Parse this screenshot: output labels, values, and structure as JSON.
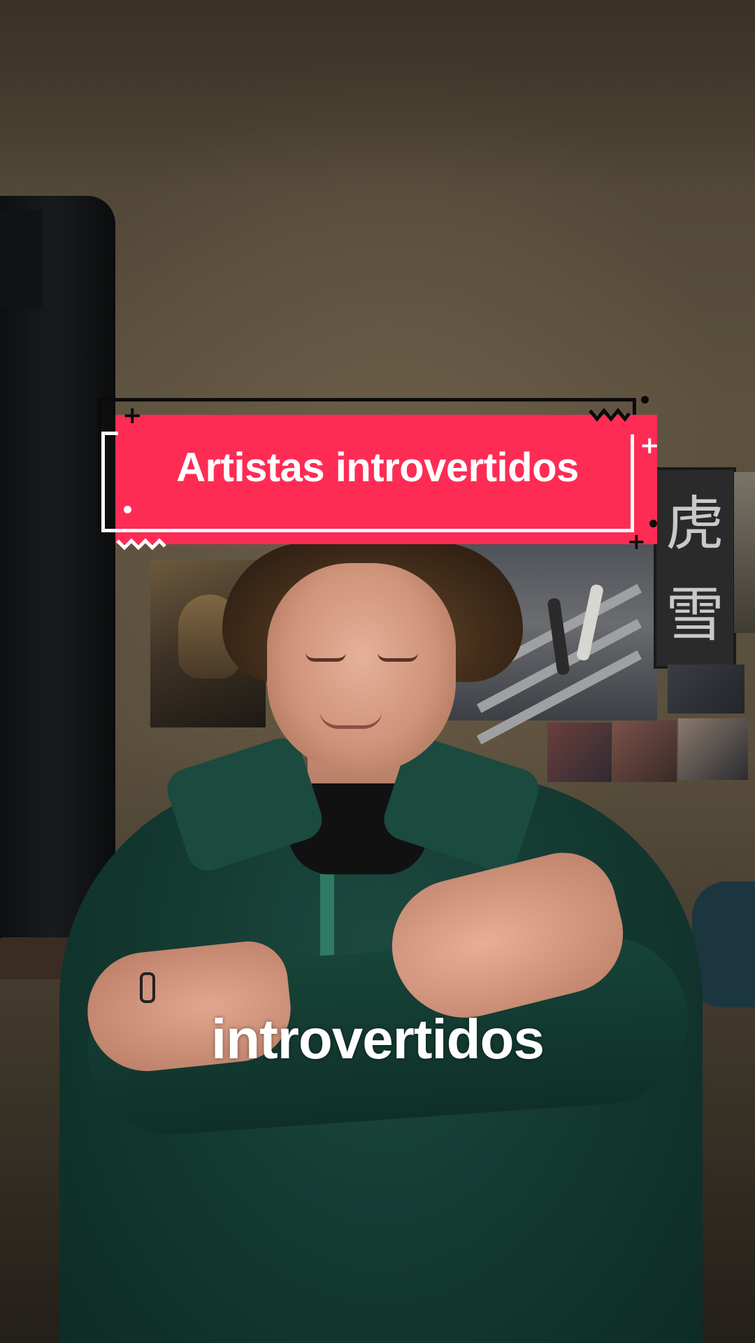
{
  "overlay": {
    "title": "Artistas introvertidos",
    "accent_color": "#fe2c55",
    "outline_color": "#0b0b0b",
    "inner_line_color": "#ffffff"
  },
  "caption": {
    "text": "introvertidos"
  },
  "wall_posters": {
    "kanji_top": "虎",
    "kanji_bottom": "雪"
  },
  "decorations": {
    "plus_glyph": "+"
  }
}
